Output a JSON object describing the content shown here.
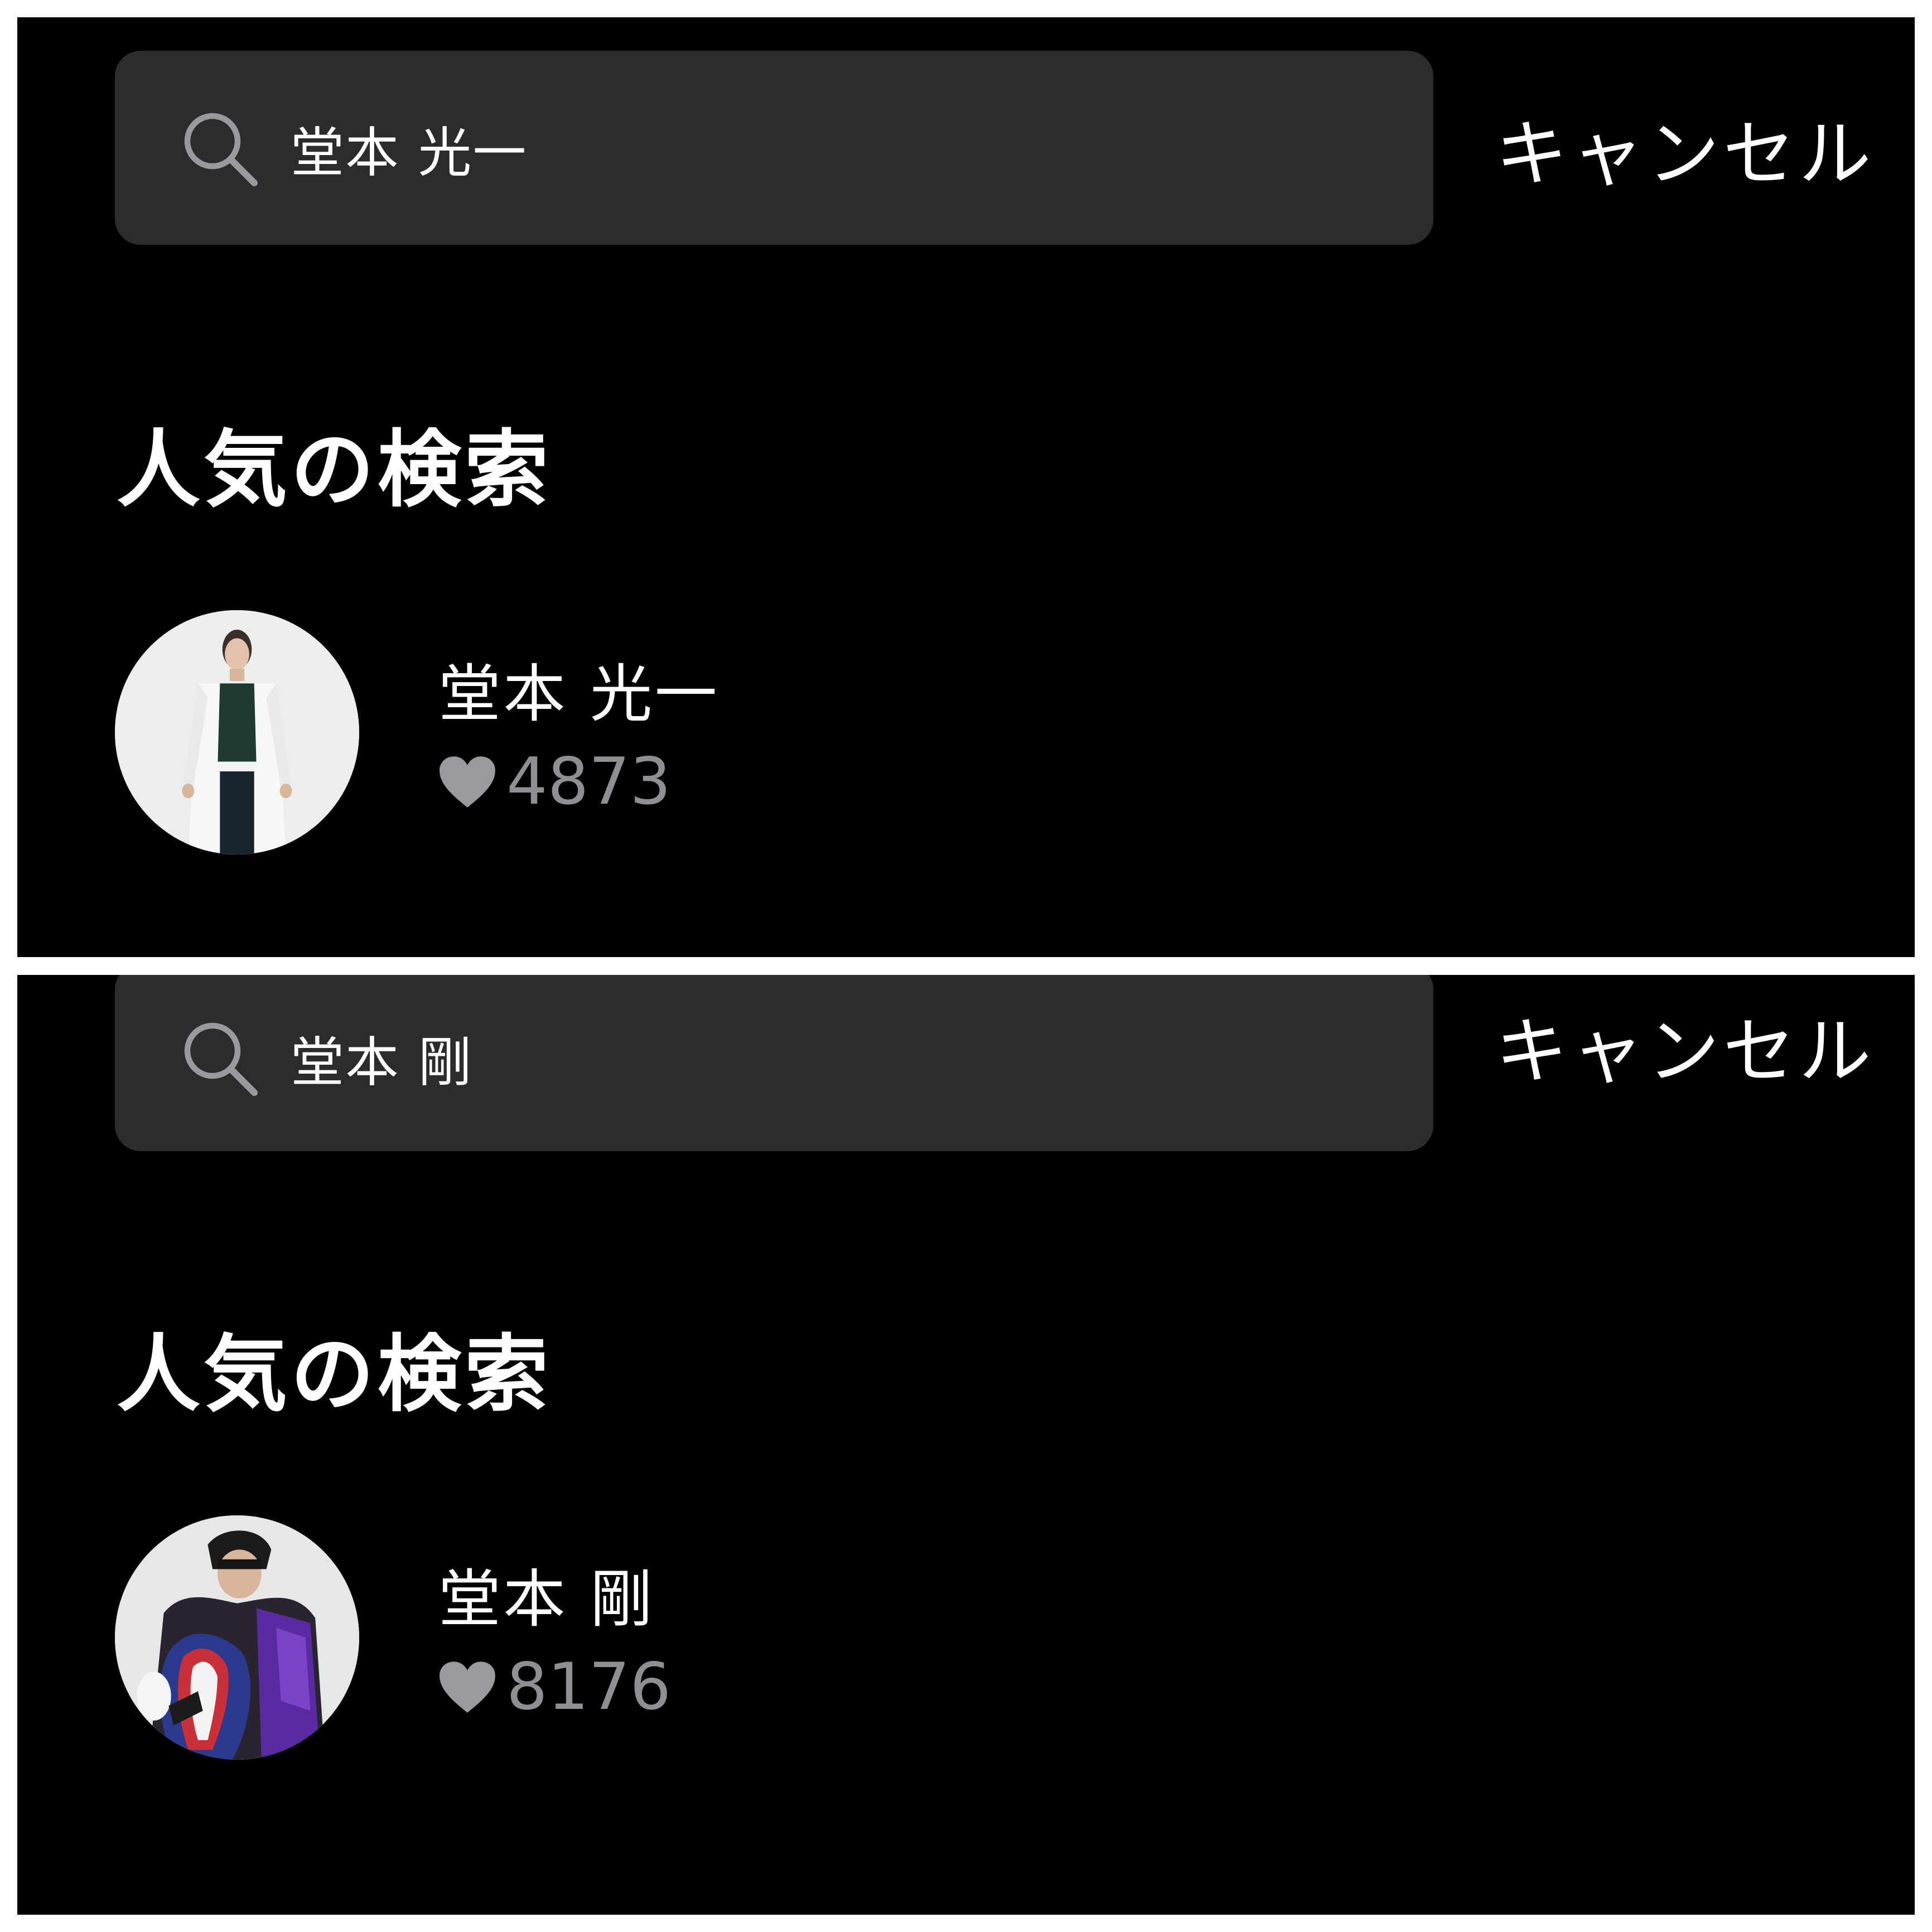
{
  "panels": [
    {
      "search": {
        "query": "堂本 光一",
        "icon": "search-icon"
      },
      "cancel_label": "キャンセル",
      "section_title": "人気の検索",
      "results": [
        {
          "name": "堂本 光一",
          "likes": "4873",
          "like_icon": "heart-icon",
          "avatar": "profile-photo"
        }
      ]
    },
    {
      "search": {
        "query": "堂本 剛",
        "icon": "search-icon"
      },
      "cancel_label": "キャンセル",
      "section_title": "人気の検索",
      "results": [
        {
          "name": "堂本 剛",
          "likes": "8176",
          "like_icon": "heart-icon",
          "avatar": "profile-photo"
        }
      ]
    }
  ],
  "colors": {
    "background": "#000000",
    "search_field": "#2c2c2e",
    "text_primary": "#ffffff",
    "text_secondary": "#8e8e93",
    "separator": "#ffffff"
  }
}
